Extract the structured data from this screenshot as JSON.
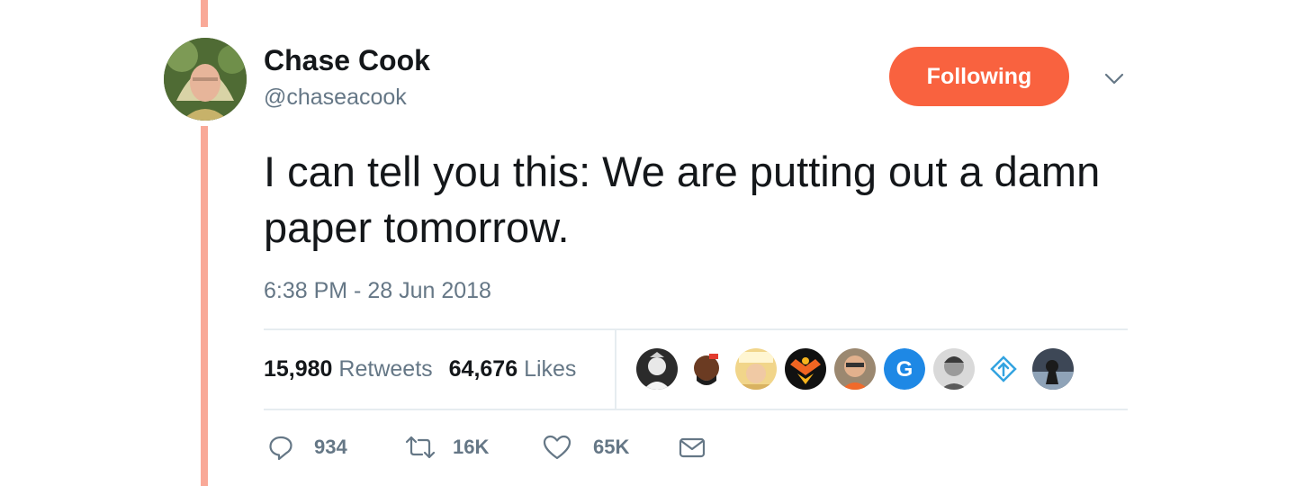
{
  "user": {
    "name": "Chase Cook",
    "handle": "@chaseacook"
  },
  "follow_button": {
    "label": "Following"
  },
  "tweet": {
    "text": "I can tell you this: We are putting out a damn paper tomorrow.",
    "timestamp": "6:38 PM - 28 Jun 2018"
  },
  "stats": {
    "retweets_count": "15,980",
    "retweets_label": "Retweets",
    "likes_count": "64,676",
    "likes_label": "Likes"
  },
  "actions": {
    "replies": "934",
    "retweets": "16K",
    "likes": "65K"
  },
  "likers": [
    {
      "icon": "liker-avatar-1"
    },
    {
      "icon": "liker-avatar-2"
    },
    {
      "icon": "liker-avatar-3"
    },
    {
      "icon": "liker-avatar-4"
    },
    {
      "icon": "liker-avatar-5"
    },
    {
      "icon": "liker-avatar-g",
      "letter": "G"
    },
    {
      "icon": "liker-avatar-7"
    },
    {
      "icon": "liker-avatar-8"
    },
    {
      "icon": "liker-avatar-9"
    }
  ],
  "colors": {
    "accent": "#f9623f",
    "thread_line": "#f9a998",
    "secondary_text": "#657786",
    "divider": "#e6ecf0"
  }
}
